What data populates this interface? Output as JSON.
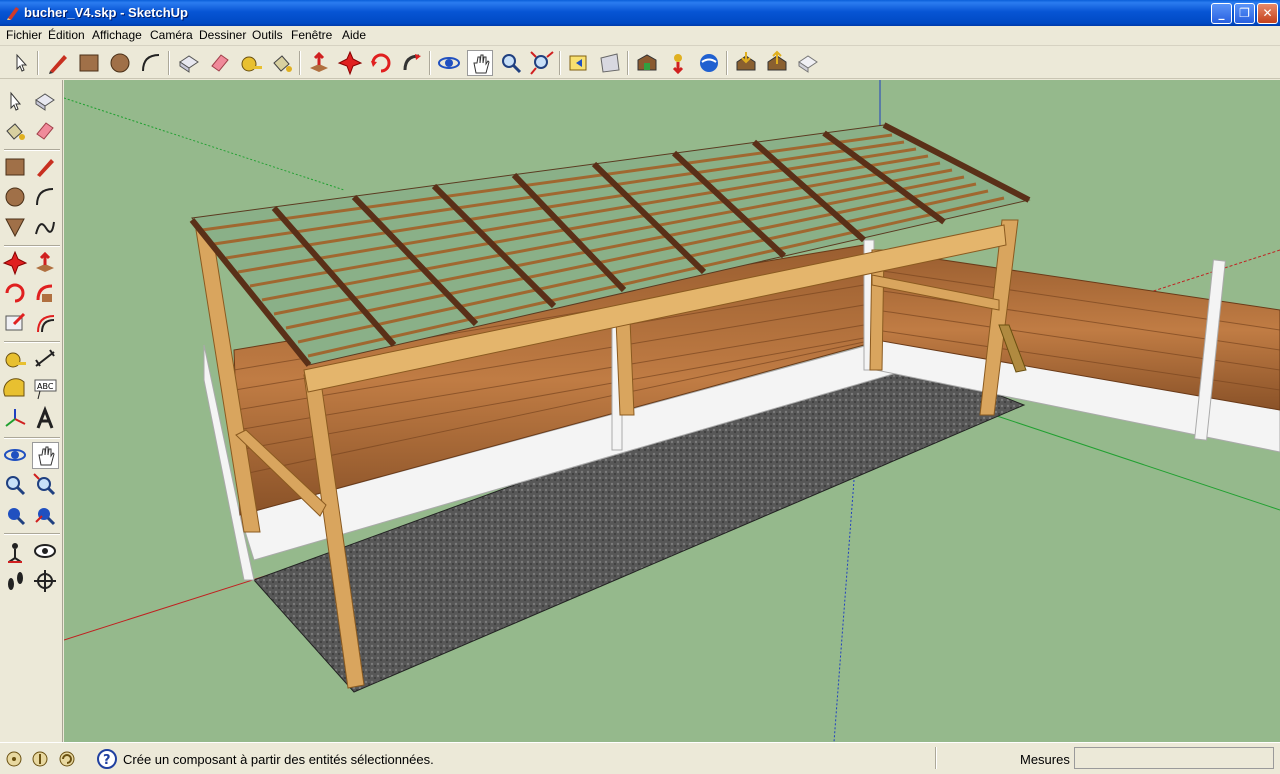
{
  "window": {
    "title": "bucher_V4.skp - SketchUp"
  },
  "menu": [
    "Fichier",
    "Édition",
    "Affichage",
    "Caméra",
    "Dessiner",
    "Outils",
    "Fenêtre",
    "Aide"
  ],
  "toolbar": {
    "tools": [
      "select",
      "pencil",
      "rectangle",
      "circle",
      "arc",
      "make-component",
      "eraser",
      "tape-measure",
      "paint-bucket",
      "push-pull",
      "move",
      "rotate",
      "follow-me",
      "orbit",
      "pan",
      "zoom",
      "zoom-extents",
      "previous-view",
      "next-view",
      "3d-warehouse",
      "get-models",
      "google-earth",
      "share-model",
      "import",
      "export"
    ],
    "active": "pan"
  },
  "left_toolbar": {
    "tools": [
      "select",
      "make-component",
      "paint-bucket",
      "eraser",
      "rectangle",
      "line",
      "circle",
      "arc",
      "polygon",
      "freehand",
      "move",
      "push-pull",
      "rotate",
      "follow-me",
      "scale",
      "offset",
      "tape-measure",
      "dimension",
      "protractor",
      "text",
      "axes",
      "3d-text",
      "orbit",
      "pan",
      "zoom",
      "zoom-window",
      "zoom-extents",
      "previous",
      "position-camera",
      "look-around",
      "walk",
      "section-plane"
    ],
    "label_abc": "ABC",
    "active": "pan"
  },
  "status": {
    "message": "Crée un composant à partir des entités sélectionnées.",
    "measure_label": "Mesures",
    "measure_value": ""
  },
  "colors": {
    "sky_ground": "#95b98c",
    "wood": "#d9a55e",
    "gravel": "#555555",
    "planks": "#a86a3a"
  }
}
